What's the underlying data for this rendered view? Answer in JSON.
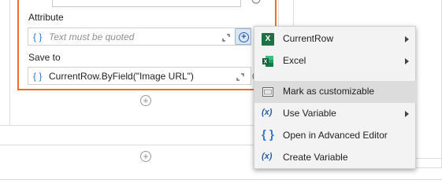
{
  "activity": {
    "attribute_label": "Attribute",
    "attribute_placeholder": "Text must be quoted",
    "save_to_label": "Save to",
    "save_to_value": "CurrentRow.ByField(\"Image URL\")",
    "brace_glyph": "{ }",
    "add_glyph": "+"
  },
  "canvas": {
    "add_glyph": "+"
  },
  "context_menu": {
    "items": [
      {
        "label": "CurrentRow",
        "icon": "excel-icon",
        "submenu": true
      },
      {
        "label": "Excel",
        "icon": "excel-icon",
        "submenu": true
      },
      {
        "label": "Mark as customizable",
        "icon": "customizable-icon",
        "submenu": false,
        "highlighted": true
      },
      {
        "label": "Use Variable",
        "icon": "variable-icon",
        "submenu": true
      },
      {
        "label": "Open in Advanced Editor",
        "icon": "braces-icon",
        "submenu": false
      },
      {
        "label": "Create Variable",
        "icon": "variable-icon",
        "submenu": false
      }
    ]
  },
  "colors": {
    "card_border": "#f26c2b",
    "accent_blue": "#2a78c9",
    "excel_green": "#1e7145",
    "menu_bg": "#f3f3f3",
    "menu_highlight": "#dcdcdc"
  }
}
